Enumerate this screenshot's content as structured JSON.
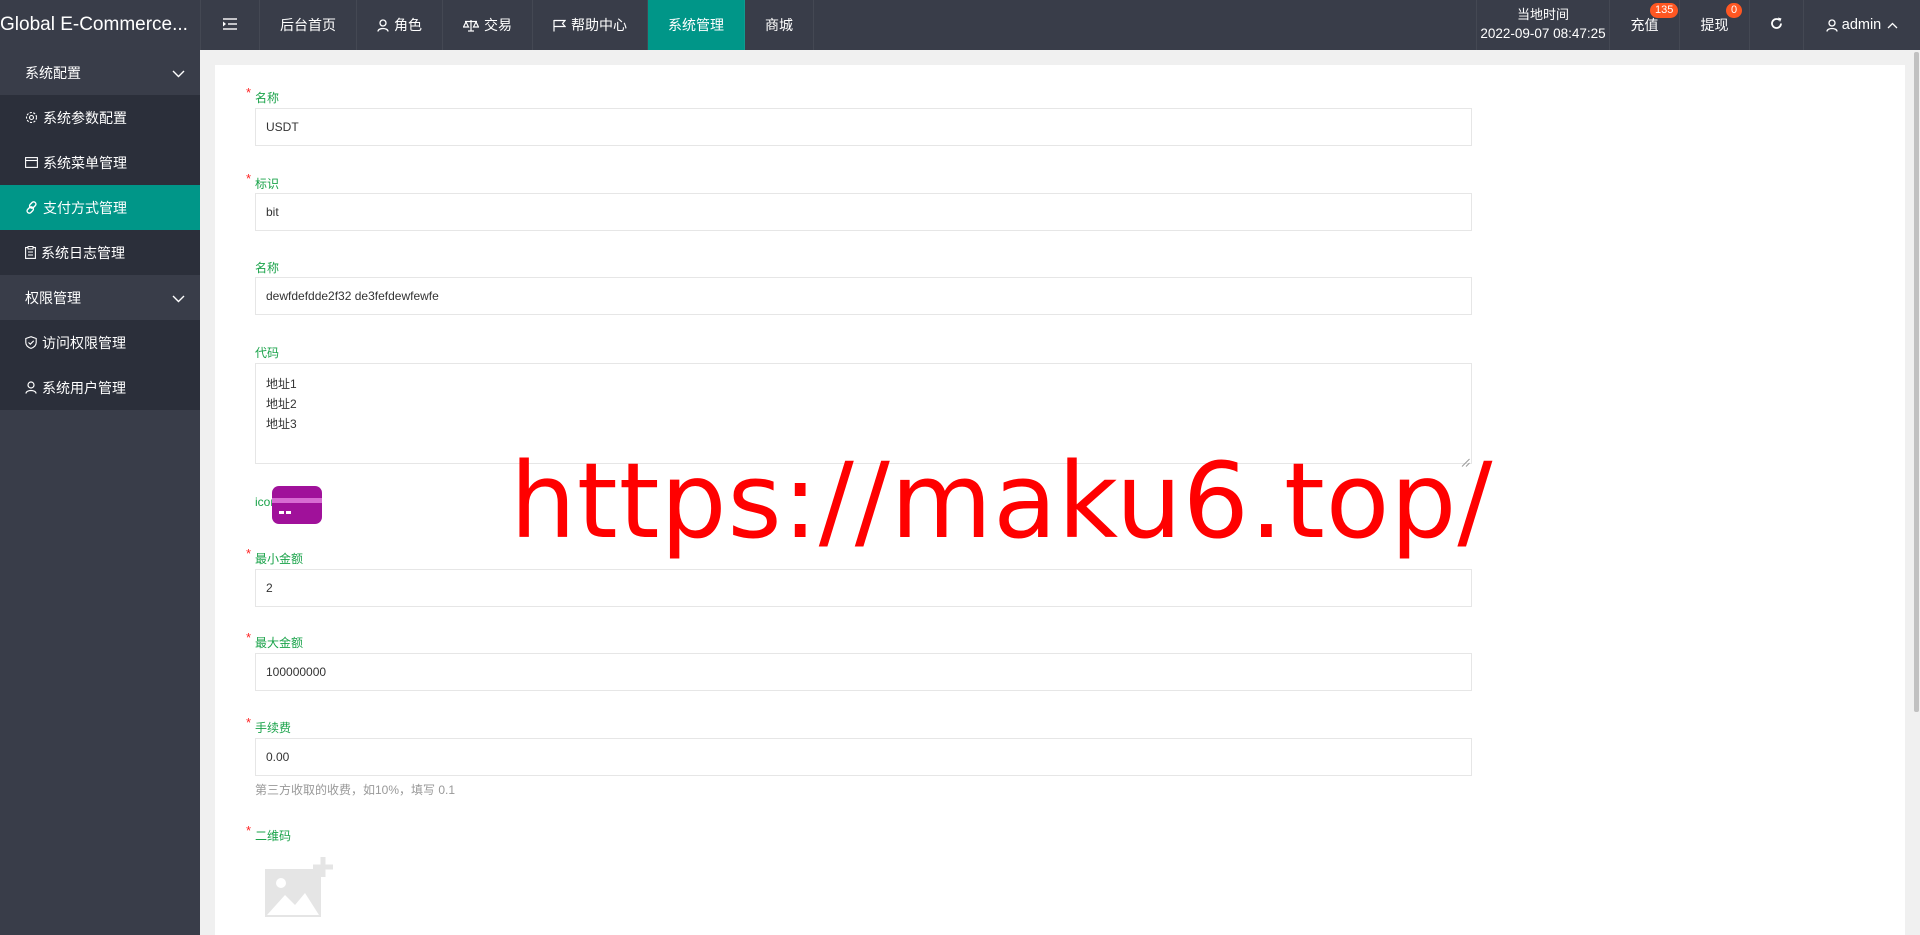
{
  "app": {
    "brand": "Global E-Commerce..."
  },
  "topnav": {
    "items": [
      {
        "label": "后台首页",
        "icon": ""
      },
      {
        "label": "角色",
        "icon": "user-icon"
      },
      {
        "label": "交易",
        "icon": "scale-icon"
      },
      {
        "label": "帮助中心",
        "icon": "flag-icon"
      },
      {
        "label": "系统管理",
        "icon": "",
        "active": true
      },
      {
        "label": "商城",
        "icon": ""
      }
    ]
  },
  "header": {
    "time_label": "当地时间",
    "time_value": "2022-09-07 08:47:25",
    "recharge_label": "充值",
    "recharge_badge": "135",
    "withdraw_label": "提现",
    "withdraw_badge": "0",
    "user": "admin"
  },
  "sidebar": {
    "groups": [
      {
        "label": "系统配置",
        "items": [
          {
            "label": "系统参数配置",
            "icon": "gear-icon"
          },
          {
            "label": "系统菜单管理",
            "icon": "window-icon"
          },
          {
            "label": "支付方式管理",
            "icon": "link-icon",
            "active": true
          },
          {
            "label": "系统日志管理",
            "icon": "clipboard-icon"
          }
        ]
      },
      {
        "label": "权限管理",
        "items": [
          {
            "label": "访问权限管理",
            "icon": "shield-check-icon"
          },
          {
            "label": "系统用户管理",
            "icon": "user-icon"
          }
        ]
      }
    ]
  },
  "form": {
    "name_label": "名称",
    "name_value": "USDT",
    "ident_label": "标识",
    "ident_value": "bit",
    "name2_label": "名称",
    "name2_value": "dewfdefdde2f32 de3fefdewfewfe",
    "code_label": "代码",
    "code_lines": [
      "地址1",
      "地址2",
      "地址3"
    ],
    "icon_label": "icon",
    "min_label": "最小金额",
    "min_value": "2",
    "max_label": "最大金额",
    "max_value": "100000000",
    "fee_label": "手续费",
    "fee_value": "0.00",
    "fee_hint": "第三方收取的收费，如10%，填写 0.1",
    "qr_label": "二维码",
    "required_mark": "*"
  },
  "watermark": "https://maku6.top/",
  "colors": {
    "accent": "#009688",
    "sidebar_bg": "#393d49",
    "label_green": "#1aa34a",
    "badge": "#ff5722",
    "icon_purple": "#a0119a",
    "watermark": "#ff0000"
  }
}
